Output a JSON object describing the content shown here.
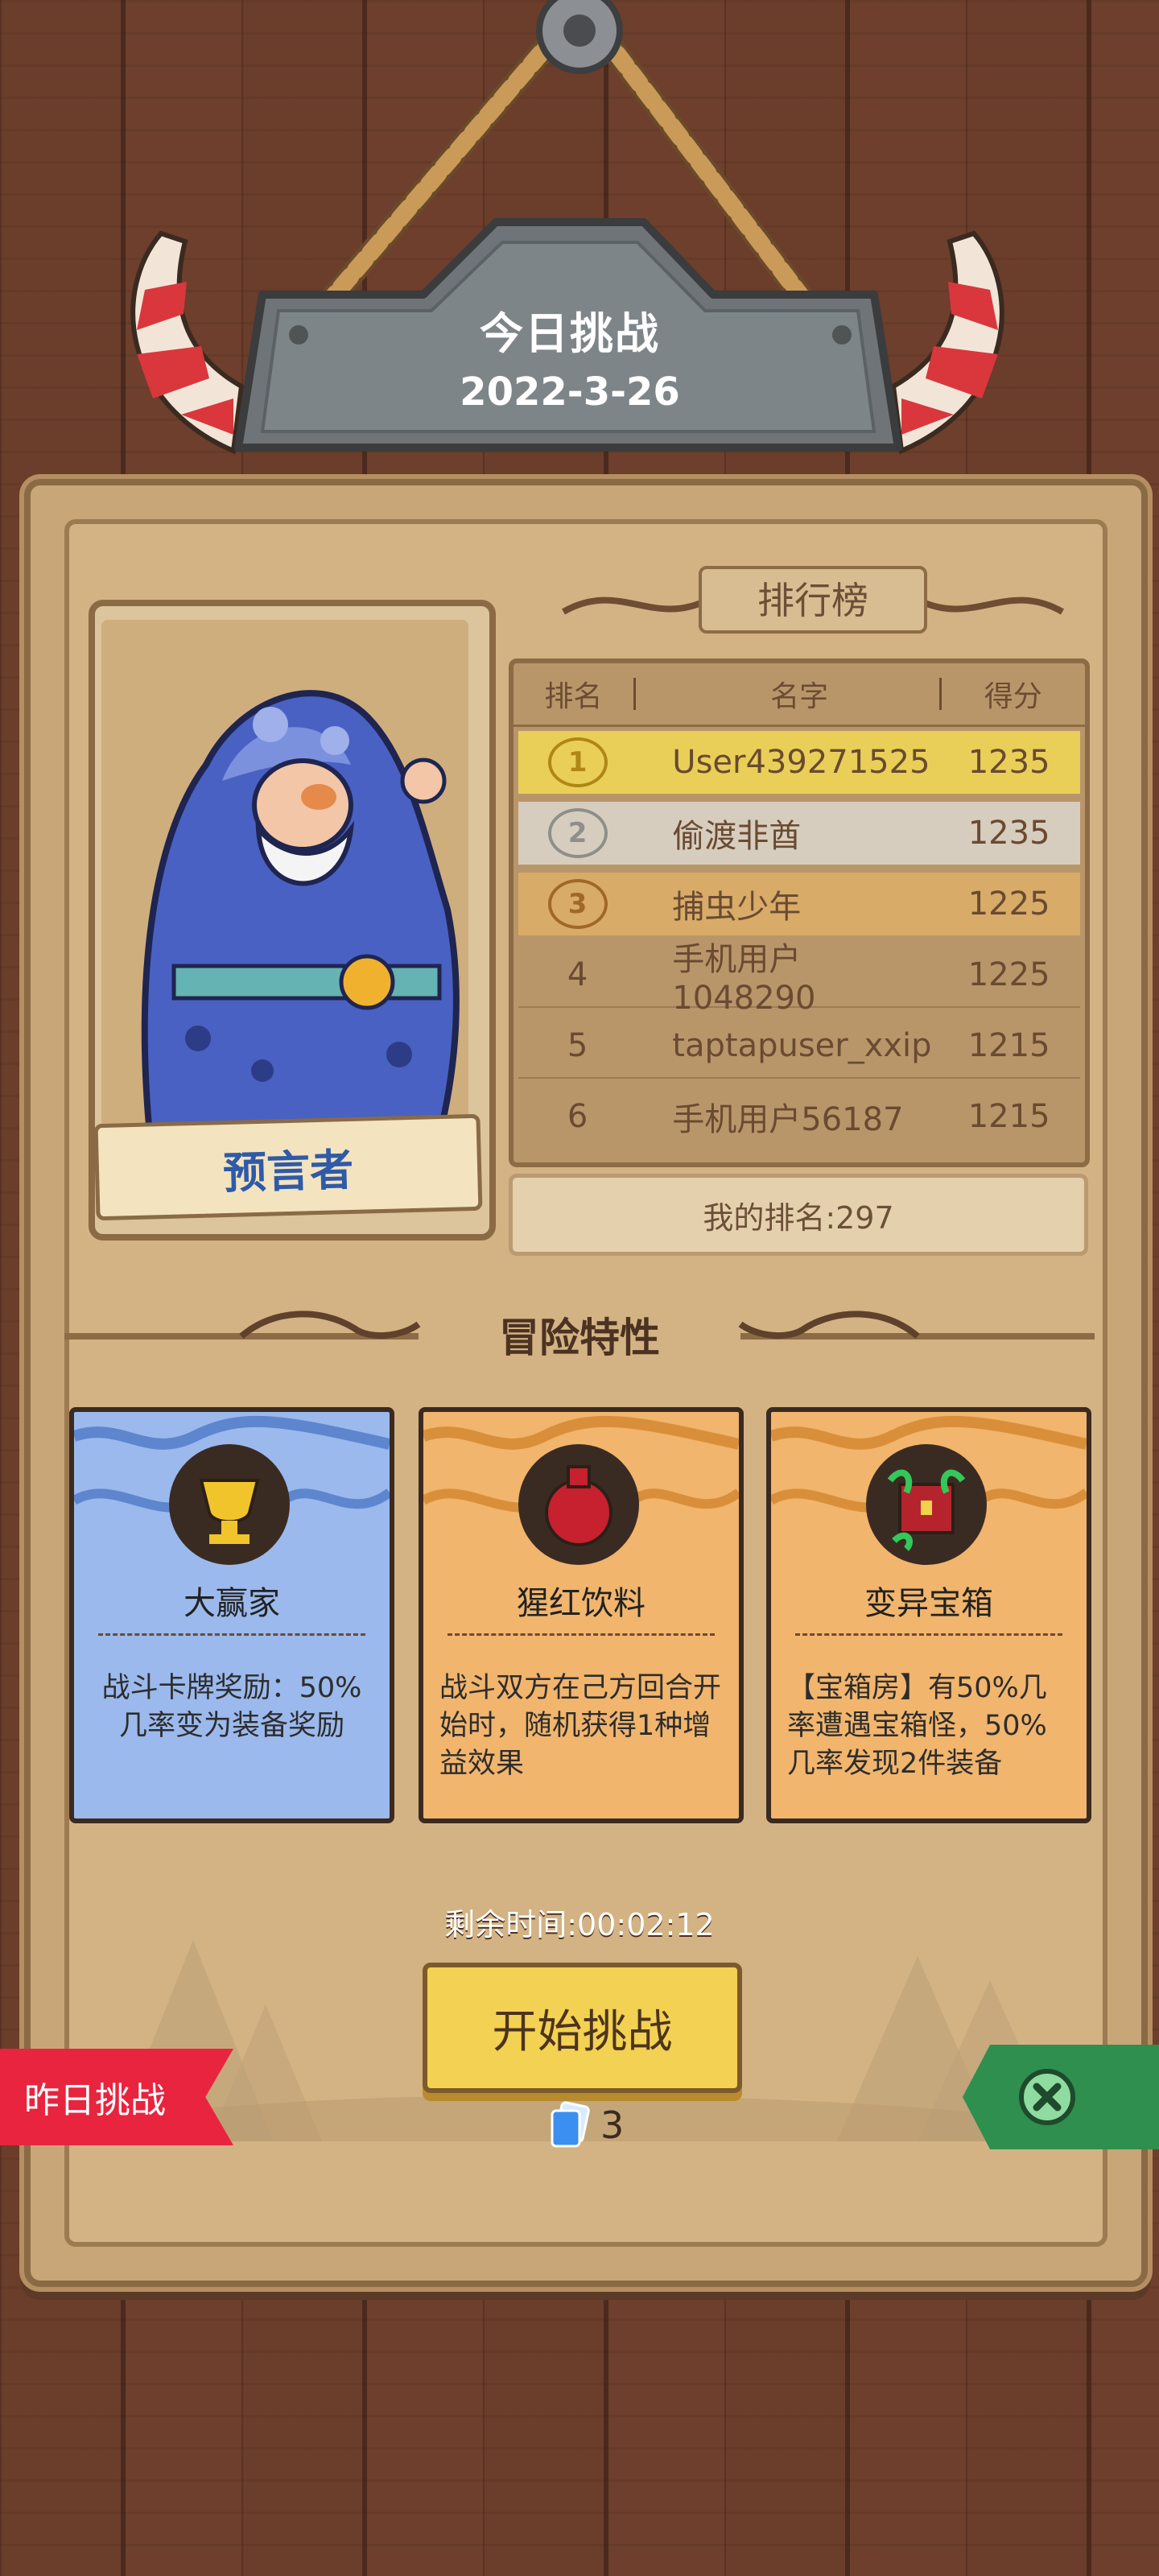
{
  "challenge": {
    "title": "今日挑战",
    "date": "2022-3-26"
  },
  "character": {
    "name": "预言者"
  },
  "leaderboard": {
    "title": "排行榜",
    "headers": {
      "rank": "排名",
      "name": "名字",
      "score": "得分"
    },
    "rows": [
      {
        "rank": "1",
        "name": "User439271525",
        "score": "1235"
      },
      {
        "rank": "2",
        "name": "偷渡非酋",
        "score": "1235"
      },
      {
        "rank": "3",
        "name": "捕虫少年",
        "score": "1225"
      },
      {
        "rank": "4",
        "name": "手机用户1048290",
        "score": "1225"
      },
      {
        "rank": "5",
        "name": "taptapuser_xxip",
        "score": "1215"
      },
      {
        "rank": "6",
        "name": "手机用户56187",
        "score": "1215"
      }
    ],
    "my_rank": "我的排名:297"
  },
  "traits_section": {
    "title": "冒险特性",
    "items": [
      {
        "name": "大赢家",
        "desc": "战斗卡牌奖励：50%几率变为装备奖励",
        "icon": "trophy-icon"
      },
      {
        "name": "猩红饮料",
        "desc": "战斗双方在己方回合开始时，随机获得1种增益效果",
        "icon": "potion-icon"
      },
      {
        "name": "变异宝箱",
        "desc": "【宝箱房】有50%几率遭遇宝箱怪，50%几率发现2件装备",
        "icon": "chest-icon"
      }
    ]
  },
  "timer": "剩余时间:00:02:12",
  "start_button": "开始挑战",
  "tickets": "3",
  "yesterday_button": "昨日挑战",
  "colors": {
    "gold_row": "#e9cf58",
    "silver_row": "#d7cdbf",
    "bronze_row": "#d8ab69",
    "start_button": "#f3d152",
    "yesterday_button": "#e9243e",
    "close_tab": "#2e8f4e"
  }
}
